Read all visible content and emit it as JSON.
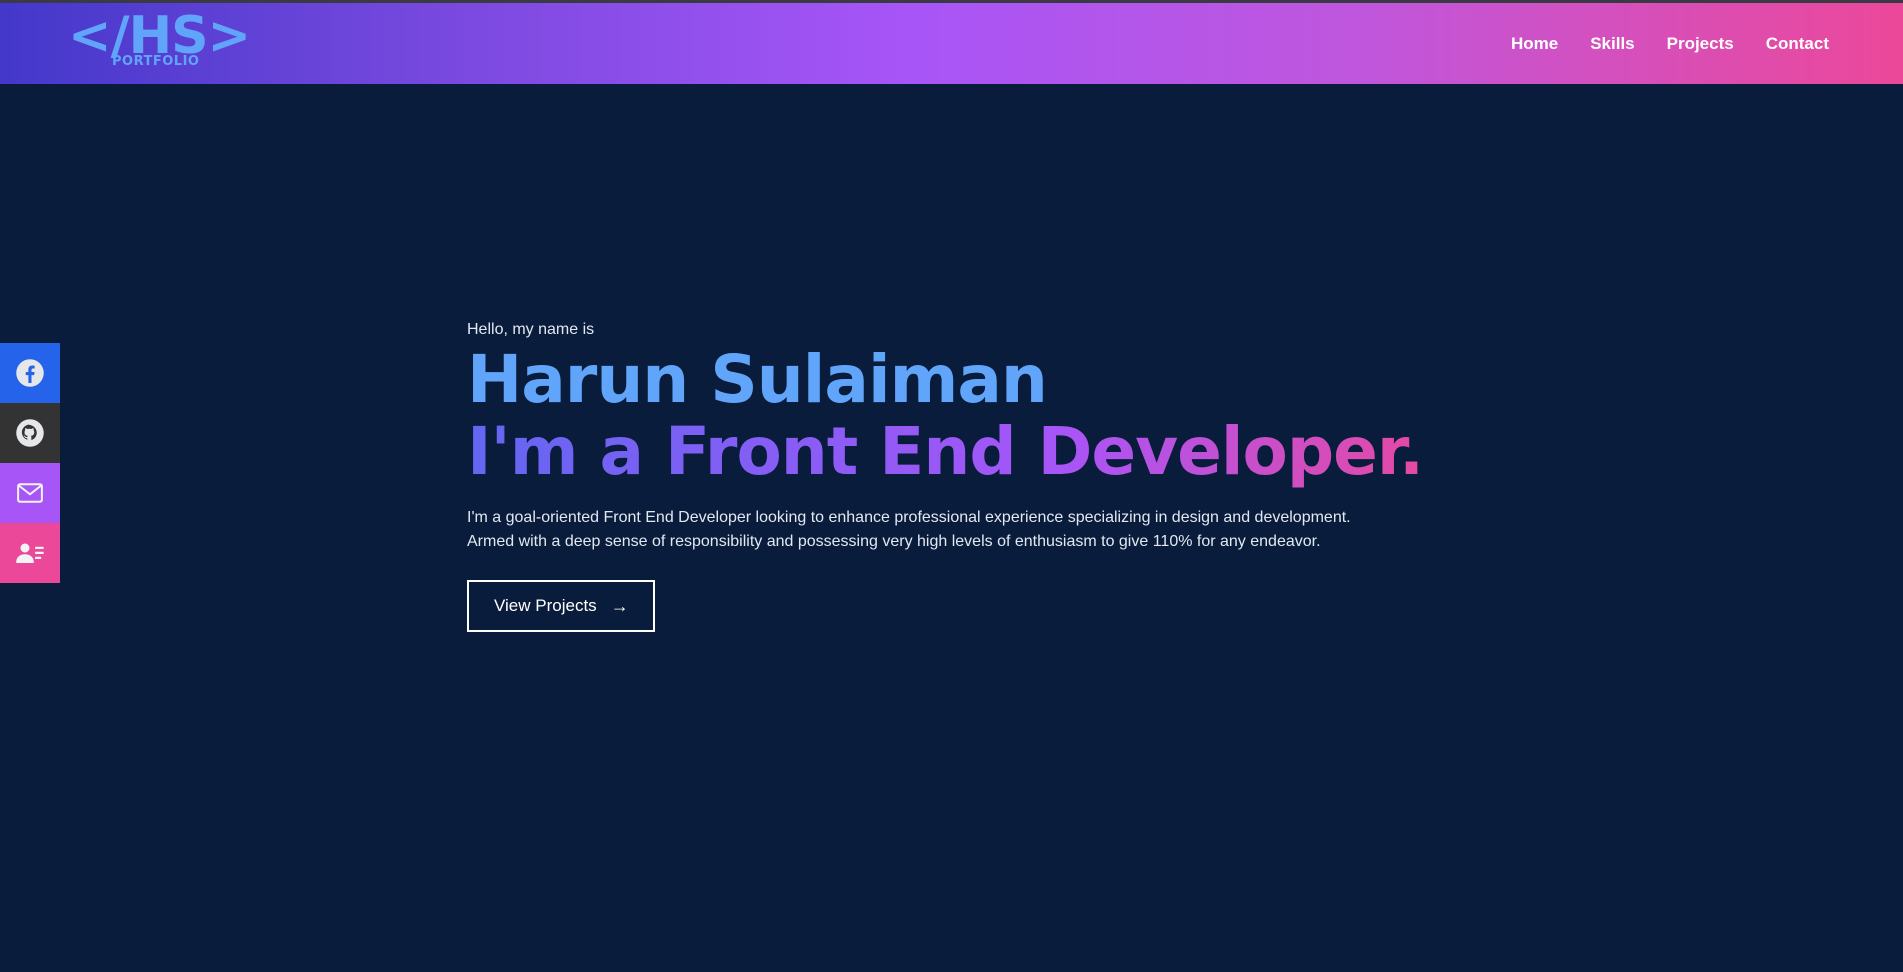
{
  "header": {
    "logo_mark": "</HS>",
    "logo_sub": "PORTFOLIO",
    "nav": [
      {
        "label": "Home"
      },
      {
        "label": "Skills"
      },
      {
        "label": "Projects"
      },
      {
        "label": "Contact"
      }
    ]
  },
  "social": [
    {
      "icon": "facebook-icon",
      "color": "#2563eb"
    },
    {
      "icon": "github-icon",
      "color": "#333333"
    },
    {
      "icon": "mail-icon",
      "color": "#a855f7"
    },
    {
      "icon": "resume-icon",
      "color": "#ec4899"
    }
  ],
  "hero": {
    "greeting": "Hello, my name is",
    "name": "Harun Sulaiman",
    "role": "I'm a Front End Developer.",
    "bio": "I'm a goal-oriented Front End Developer looking to enhance professional experience specializing in design and development. Armed with a deep sense of responsibility and possessing very high levels of enthusiasm to give 110% for any endeavor.",
    "cta_label": "View Projects",
    "cta_icon": "arrow-right-icon"
  },
  "colors": {
    "background": "#0a1c3c",
    "name": "#60a5fa",
    "gradient_start": "#6366f1",
    "gradient_end": "#ec4899"
  }
}
